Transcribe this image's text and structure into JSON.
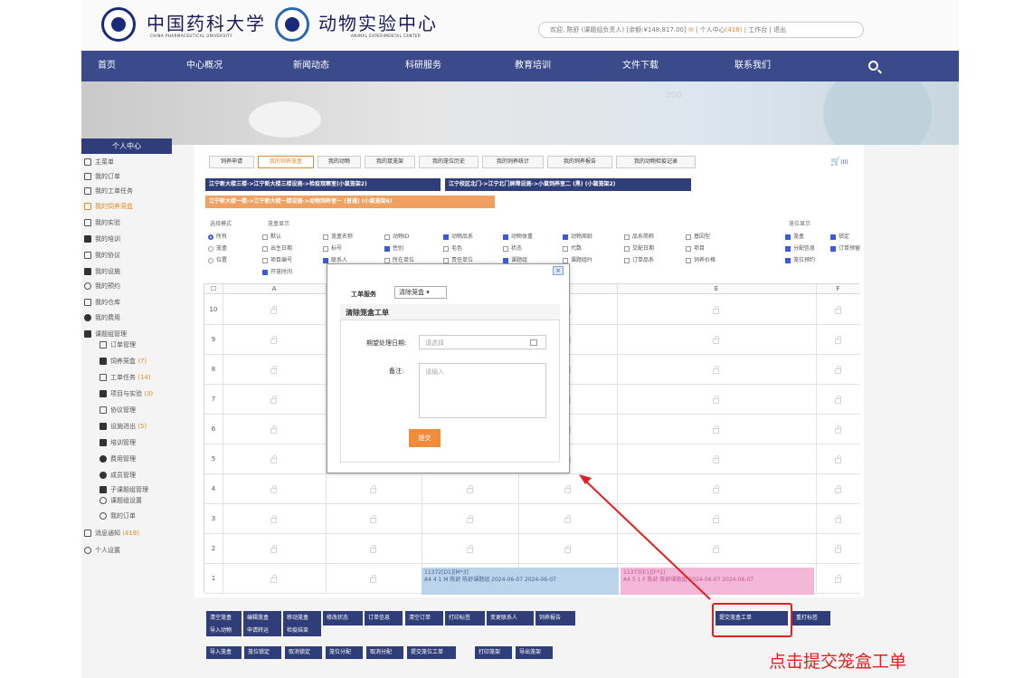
{
  "header": {
    "university_cn": "中国药科大学",
    "university_en": "CHINA PHARMACEUTICAL UNIVERSITY",
    "center_cn": "动物实验中心",
    "center_en": "ANIMAL EXPERIMENTAL CENTER",
    "user_bar": {
      "welcome": "欢迎, 陈舒 (课题组负责人) [余额:¥148,817.00]",
      "msg_count": "(418)",
      "personal": "个人中心",
      "workbench": "工作台",
      "logout": "退出"
    }
  },
  "nav": [
    "首页",
    "中心概况",
    "新闻动态",
    "科研服务",
    "教育培训",
    "文件下载",
    "联系我们"
  ],
  "banner_number": "200",
  "sidebar": {
    "title": "个人中心",
    "items": [
      {
        "label": "主菜单"
      },
      {
        "label": "我的订单"
      },
      {
        "label": "我的工单任务"
      },
      {
        "label": "我的饲养笼盒",
        "active": true
      },
      {
        "label": "我的实验"
      },
      {
        "label": "我的培训"
      },
      {
        "label": "我的协议"
      },
      {
        "label": "我的设施"
      },
      {
        "label": "我的预约"
      },
      {
        "label": "我的仓库"
      },
      {
        "label": "我的费用"
      },
      {
        "label": "课题组管理"
      }
    ],
    "sub": [
      {
        "label": "订单管理",
        "count": ""
      },
      {
        "label": "饲养笼盒",
        "count": "(7)"
      },
      {
        "label": "工单任务",
        "count": "(14)"
      },
      {
        "label": "项目与实验",
        "count": "(3)"
      },
      {
        "label": "协议管理",
        "count": ""
      },
      {
        "label": "设施进出",
        "count": "(5)"
      },
      {
        "label": "培训管理",
        "count": ""
      },
      {
        "label": "费用管理",
        "count": ""
      },
      {
        "label": "成员管理",
        "count": ""
      },
      {
        "label": "子课题组管理",
        "count": ""
      },
      {
        "label": "课题组设置",
        "count": ""
      },
      {
        "label": "我的订单",
        "count": ""
      }
    ],
    "bottom": [
      {
        "label": "消息通知",
        "count": "(418)"
      },
      {
        "label": "个人设置",
        "count": ""
      }
    ]
  },
  "tabs": [
    "饲养申请",
    "我的饲养笼盒",
    "我的动物",
    "我的鼠笼架",
    "我的笼位历史",
    "我的饲养统计",
    "我的饲养报告",
    "我的动物检疫记录"
  ],
  "cart_count": "(0)",
  "crumbs": [
    "江宁新大楼三楼->江宁新大楼三楼设施->检疫观察室(小鼠笼架2)",
    "江宁校区北门->江宁北门屏障设施->小鼠饲养室二 (黑) (小鼠笼架2)",
    "江宁新大楼一楼->江宁新大楼一楼设施->动物饲养室一 (普通) (小鼠笼架6)"
  ],
  "filters": {
    "select_mode_label": "选择模式",
    "select_modes": [
      {
        "label": "所有",
        "on": true
      },
      {
        "label": "笼盒",
        "on": false
      },
      {
        "label": "位置",
        "on": false
      }
    ],
    "display_label": "笼盒显示",
    "display_opts": [
      {
        "label": "默认",
        "on": false
      },
      {
        "label": "笼盒名称",
        "on": false
      },
      {
        "label": "动物ID",
        "on": false
      },
      {
        "label": "动物品系",
        "on": true
      },
      {
        "label": "动物体重",
        "on": true
      },
      {
        "label": "动物周龄",
        "on": true
      },
      {
        "label": "品系简称",
        "on": false
      },
      {
        "label": "基因型",
        "on": false
      },
      {
        "label": "出生日期",
        "on": false
      },
      {
        "label": "标号",
        "on": false
      },
      {
        "label": "性别",
        "on": true
      },
      {
        "label": "毛色",
        "on": false
      },
      {
        "label": "状态",
        "on": false
      },
      {
        "label": "代数",
        "on": false
      },
      {
        "label": "交配日期",
        "on": false
      },
      {
        "label": "项目",
        "on": false
      },
      {
        "label": "项目编号",
        "on": false
      },
      {
        "label": "联系人",
        "on": true
      },
      {
        "label": "所在单位",
        "on": false
      },
      {
        "label": "责任单位",
        "on": false
      },
      {
        "label": "课题组",
        "on": true
      },
      {
        "label": "课题组PI",
        "on": false
      },
      {
        "label": "订单品系",
        "on": false
      },
      {
        "label": "饲养价格",
        "on": false
      },
      {
        "label": "开笼时间",
        "on": true
      }
    ],
    "position_label": "笼位显示",
    "position_opts": [
      {
        "label": "笼盒",
        "on": true
      },
      {
        "label": "锁定",
        "on": true
      },
      {
        "label": "分配信息",
        "on": true
      },
      {
        "label": "订单预留",
        "on": true
      },
      {
        "label": "笼位预约",
        "on": true
      }
    ]
  },
  "grid": {
    "columns": [
      "A",
      "B",
      "C",
      "D",
      "E",
      "F"
    ],
    "rows": [
      "10",
      "9",
      "8",
      "7",
      "6",
      "5",
      "4",
      "3",
      "2",
      "1"
    ],
    "cage1_line1": "11372[D1][M*3]",
    "cage1_line2": "A4 4 1 M 陈舒 陈舒课题组 2024-06-07 2024-06-07",
    "cage2_line1": "11373[E1][F*2]",
    "cage2_line2": "A4 5 1 F 陈舒 陈舒课题组 2024-06-07 2024-06-07"
  },
  "modal": {
    "close": "×",
    "wo_type_label": "工单服务",
    "wo_type_value": "清除笼盒",
    "form_title": "清除笼盒工单",
    "date_label": "期望处理日期:",
    "date_placeholder": "请选择",
    "remark_label": "备注:",
    "remark_placeholder": "请输入",
    "submit": "提交"
  },
  "toolbar_row1": [
    "清空笼盒",
    "编辑笼盒",
    "移动笼盒",
    "修改状态",
    "订单信息",
    "清空订单",
    "打印标签",
    "变更联系人",
    "饲养报告",
    "提交笼盒工单",
    "重打标签"
  ],
  "toolbar_row2": [
    "导入动物",
    "申请转运",
    "检疫结束"
  ],
  "toolbar_row3": [
    "导入笼盒",
    "笼位锁定",
    "取消锁定",
    "笼位分配",
    "取消分配",
    "提交笼位工单",
    "打印笼架",
    "导出笼架"
  ],
  "annotation": "点击提交笼盒工单",
  "colors": {
    "brand": "#3a4a8a",
    "orange": "#e58a2a",
    "annot": "#e02020"
  }
}
